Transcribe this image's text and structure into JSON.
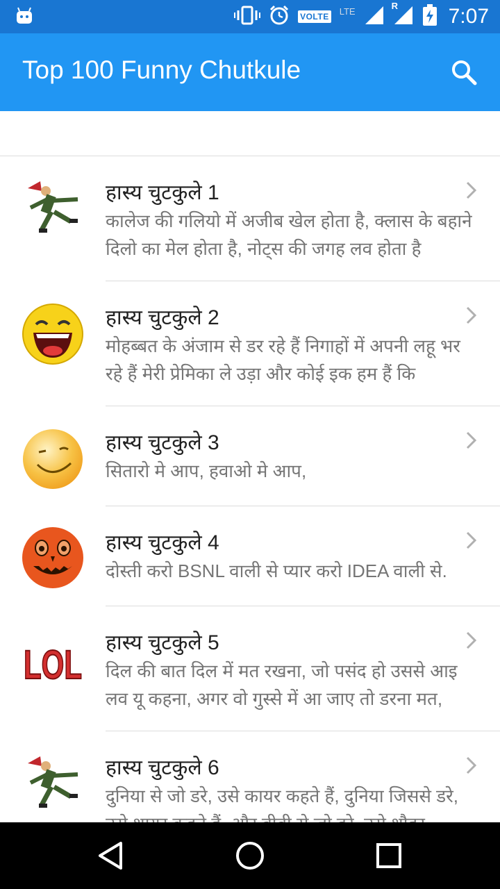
{
  "status_bar": {
    "time": "7:07",
    "volte_label": "VOLTE",
    "lte_label": "LTE",
    "roaming_label": "R"
  },
  "app_bar": {
    "title": "Top 100 Funny Chutkule",
    "search_icon": "search-icon"
  },
  "list": {
    "items": [
      {
        "title": "हास्य चुटकुले 1",
        "desc": "कालेज की गलियो में अजीब खेल होता है, क्लास के बहाने दिलो का मेल होता है, नोट्स की जगह लव होता है",
        "icon": "dancing-man-icon"
      },
      {
        "title": "हास्य चुटकुले 2",
        "desc": "मोहब्बत के अंजाम से डर रहे हैं निगाहों में अपनी लहू भर रहे हैं मेरी प्रेमिका ले उड़ा और कोई इक हम हैं कि",
        "icon": "laughing-smiley-icon"
      },
      {
        "title": "हास्य चुटकुले 3",
        "desc": "सितारो मे आप, हवाओ मे आप,",
        "icon": "winking-smiley-icon"
      },
      {
        "title": "हास्य चुटकुले 4",
        "desc": "दोस्ती करो BSNL वाली से प्यार करो IDEA वाली से.",
        "icon": "pumpkin-face-icon"
      },
      {
        "title": "हास्य चुटकुले 5",
        "desc": "दिल की बात दिल में मत रखना, जो पसंद हो उससे आइ लव यू कहना, अगर वो गुस्से में आ जाए तो डरना मत,",
        "icon": "lol-text-icon",
        "icon_text": "LOL"
      },
      {
        "title": "हास्य चुटकुले 6",
        "desc": "दुनिया से जो डरे, उसे कायर कहते हैं, दुनिया जिससे डरे, उसे शायर कहते हैं, और बीवी से जो डरे, उसे शौहर",
        "icon": "dancing-man-icon"
      }
    ]
  },
  "nav_bar": {
    "back_icon": "back-triangle-icon",
    "home_icon": "home-circle-icon",
    "recents_icon": "recents-square-icon"
  }
}
